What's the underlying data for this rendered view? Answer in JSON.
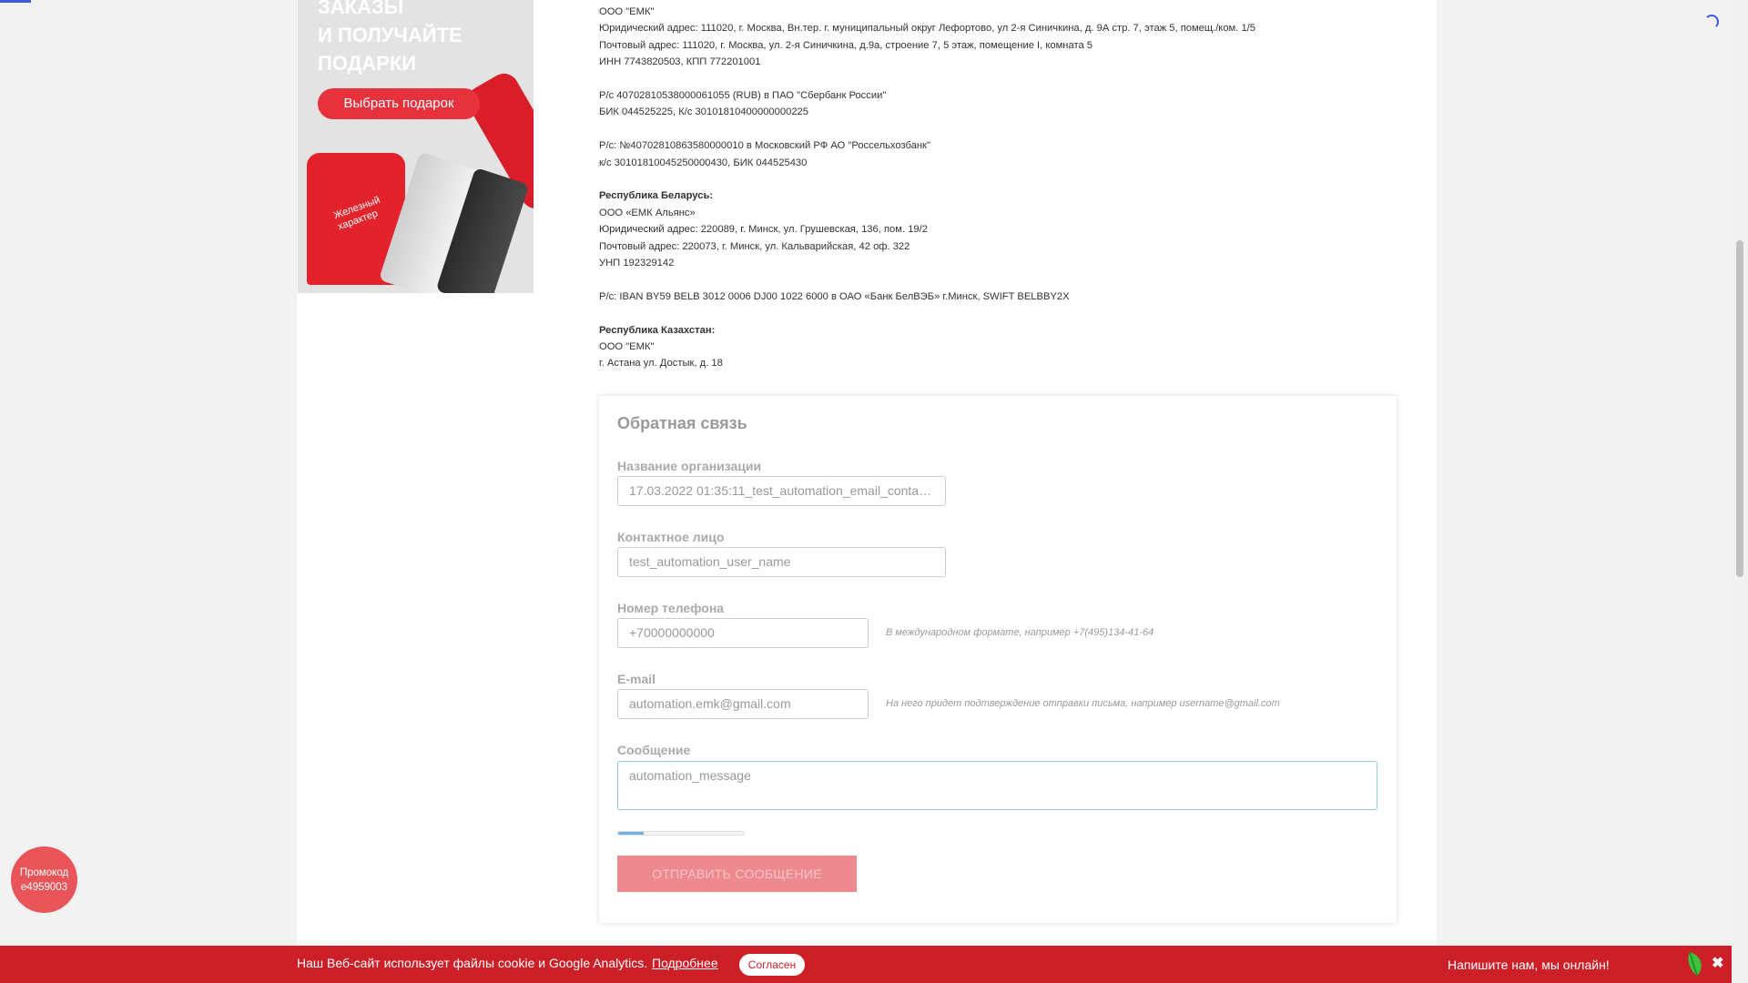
{
  "banner": {
    "title_lines": [
      "ЗАКАЗЫ",
      "И ПОЛУЧАЙТЕ",
      "ПОДАРКИ"
    ],
    "button_label": "Выбрать подарок",
    "shirt_text": "Железный характер"
  },
  "requisites": {
    "russia": [
      "ООО \"ЕМК\"",
      "Юридический адрес: 111020, г. Москва, Вн.тер. г. муниципальный округ Лефортово, ул 2-я Синичкина, д. 9А стр. 7, этаж 5, помещ./ком. 1/5",
      "Почтовый адрес: 111020, г. Москва, ул. 2-я Синичкина, д.9а, строение 7, 5 этаж, помещение I, комната 5",
      "ИНН 7743820503, КПП 772201001"
    ],
    "bank1": [
      "Р/с 40702810538000061055 (RUB) в ПАО \"Сбербанк России\"",
      "БИК 044525225, К/с 30101810400000000225"
    ],
    "bank2": [
      "Р/с: №40702810863580000010 в Московский РФ АО \"Россельхозбанк\"",
      "к/с 30101810045250000430, БИК 044525430"
    ],
    "belarus_heading": "Республика Беларусь:",
    "belarus": [
      "ООО «ЕМК Альянс»",
      "Юридический адрес: 220089, г. Минск, ул. Грушевская, 136, пом. 19/2",
      "Почтовый адрес: 220073, г. Минск, ул. Кальварийская, 42 оф. 322",
      "УНП 192329142"
    ],
    "belarus_bank": "Р/с: IBAN BY59 BELB 3012 0006 DJ00 1022 6000 в ОАО «Банк БелВЭБ» г.Минск, SWIFT BELBBY2X",
    "kazakhstan_heading": "Республика Казахстан:",
    "kazakhstan": [
      "ООО \"ЕМК\"",
      "г. Астана ул. Достык, д. 18"
    ]
  },
  "feedback": {
    "title": "Обратная связь",
    "org_label": "Название организации",
    "org_value": "17.03.2022 01:35:11_test_automation_email_contacts",
    "contact_label": "Контактное лицо",
    "contact_value": "test_automation_user_name",
    "phone_label": "Номер телефона",
    "phone_value": "+70000000000",
    "phone_hint": "В международном формате, например +7(495)134-41-64",
    "email_label": "E-mail",
    "email_value": "automation.emk@gmail.com",
    "email_hint": "На него придет подтверждение отправки письма, например username@gmail.com",
    "message_label": "Сообщение",
    "message_value": "automation_message",
    "progress_fraction": 0.2,
    "submit_label": "ОТПРАВИТЬ СООБЩЕНИЕ"
  },
  "promo": {
    "label": "Промокод",
    "code": "e4959003"
  },
  "cookie": {
    "text": "Наш Веб-сайт использует файлы cookie и Google Analytics.",
    "link": "Подробнее",
    "button": "Согласен"
  },
  "chat": {
    "text": "Напишите нам, мы онлайн!"
  },
  "colors": {
    "brand_red": "#cc1f28",
    "accent_blue": "#3b5bdb"
  },
  "icons": [
    "loading-spinner-icon",
    "leaf-icon",
    "close-icon"
  ]
}
